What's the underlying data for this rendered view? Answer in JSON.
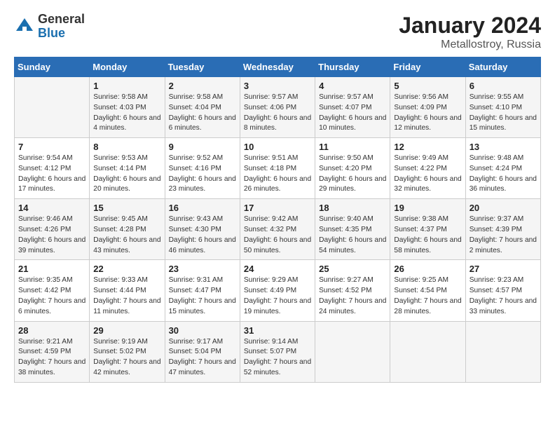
{
  "header": {
    "logo_general": "General",
    "logo_blue": "Blue",
    "title": "January 2024",
    "subtitle": "Metallostroy, Russia"
  },
  "days_of_week": [
    "Sunday",
    "Monday",
    "Tuesday",
    "Wednesday",
    "Thursday",
    "Friday",
    "Saturday"
  ],
  "weeks": [
    [
      {
        "day": "",
        "sunrise": "",
        "sunset": "",
        "daylight": ""
      },
      {
        "day": "1",
        "sunrise": "Sunrise: 9:58 AM",
        "sunset": "Sunset: 4:03 PM",
        "daylight": "Daylight: 6 hours and 4 minutes."
      },
      {
        "day": "2",
        "sunrise": "Sunrise: 9:58 AM",
        "sunset": "Sunset: 4:04 PM",
        "daylight": "Daylight: 6 hours and 6 minutes."
      },
      {
        "day": "3",
        "sunrise": "Sunrise: 9:57 AM",
        "sunset": "Sunset: 4:06 PM",
        "daylight": "Daylight: 6 hours and 8 minutes."
      },
      {
        "day": "4",
        "sunrise": "Sunrise: 9:57 AM",
        "sunset": "Sunset: 4:07 PM",
        "daylight": "Daylight: 6 hours and 10 minutes."
      },
      {
        "day": "5",
        "sunrise": "Sunrise: 9:56 AM",
        "sunset": "Sunset: 4:09 PM",
        "daylight": "Daylight: 6 hours and 12 minutes."
      },
      {
        "day": "6",
        "sunrise": "Sunrise: 9:55 AM",
        "sunset": "Sunset: 4:10 PM",
        "daylight": "Daylight: 6 hours and 15 minutes."
      }
    ],
    [
      {
        "day": "7",
        "sunrise": "Sunrise: 9:54 AM",
        "sunset": "Sunset: 4:12 PM",
        "daylight": "Daylight: 6 hours and 17 minutes."
      },
      {
        "day": "8",
        "sunrise": "Sunrise: 9:53 AM",
        "sunset": "Sunset: 4:14 PM",
        "daylight": "Daylight: 6 hours and 20 minutes."
      },
      {
        "day": "9",
        "sunrise": "Sunrise: 9:52 AM",
        "sunset": "Sunset: 4:16 PM",
        "daylight": "Daylight: 6 hours and 23 minutes."
      },
      {
        "day": "10",
        "sunrise": "Sunrise: 9:51 AM",
        "sunset": "Sunset: 4:18 PM",
        "daylight": "Daylight: 6 hours and 26 minutes."
      },
      {
        "day": "11",
        "sunrise": "Sunrise: 9:50 AM",
        "sunset": "Sunset: 4:20 PM",
        "daylight": "Daylight: 6 hours and 29 minutes."
      },
      {
        "day": "12",
        "sunrise": "Sunrise: 9:49 AM",
        "sunset": "Sunset: 4:22 PM",
        "daylight": "Daylight: 6 hours and 32 minutes."
      },
      {
        "day": "13",
        "sunrise": "Sunrise: 9:48 AM",
        "sunset": "Sunset: 4:24 PM",
        "daylight": "Daylight: 6 hours and 36 minutes."
      }
    ],
    [
      {
        "day": "14",
        "sunrise": "Sunrise: 9:46 AM",
        "sunset": "Sunset: 4:26 PM",
        "daylight": "Daylight: 6 hours and 39 minutes."
      },
      {
        "day": "15",
        "sunrise": "Sunrise: 9:45 AM",
        "sunset": "Sunset: 4:28 PM",
        "daylight": "Daylight: 6 hours and 43 minutes."
      },
      {
        "day": "16",
        "sunrise": "Sunrise: 9:43 AM",
        "sunset": "Sunset: 4:30 PM",
        "daylight": "Daylight: 6 hours and 46 minutes."
      },
      {
        "day": "17",
        "sunrise": "Sunrise: 9:42 AM",
        "sunset": "Sunset: 4:32 PM",
        "daylight": "Daylight: 6 hours and 50 minutes."
      },
      {
        "day": "18",
        "sunrise": "Sunrise: 9:40 AM",
        "sunset": "Sunset: 4:35 PM",
        "daylight": "Daylight: 6 hours and 54 minutes."
      },
      {
        "day": "19",
        "sunrise": "Sunrise: 9:38 AM",
        "sunset": "Sunset: 4:37 PM",
        "daylight": "Daylight: 6 hours and 58 minutes."
      },
      {
        "day": "20",
        "sunrise": "Sunrise: 9:37 AM",
        "sunset": "Sunset: 4:39 PM",
        "daylight": "Daylight: 7 hours and 2 minutes."
      }
    ],
    [
      {
        "day": "21",
        "sunrise": "Sunrise: 9:35 AM",
        "sunset": "Sunset: 4:42 PM",
        "daylight": "Daylight: 7 hours and 6 minutes."
      },
      {
        "day": "22",
        "sunrise": "Sunrise: 9:33 AM",
        "sunset": "Sunset: 4:44 PM",
        "daylight": "Daylight: 7 hours and 11 minutes."
      },
      {
        "day": "23",
        "sunrise": "Sunrise: 9:31 AM",
        "sunset": "Sunset: 4:47 PM",
        "daylight": "Daylight: 7 hours and 15 minutes."
      },
      {
        "day": "24",
        "sunrise": "Sunrise: 9:29 AM",
        "sunset": "Sunset: 4:49 PM",
        "daylight": "Daylight: 7 hours and 19 minutes."
      },
      {
        "day": "25",
        "sunrise": "Sunrise: 9:27 AM",
        "sunset": "Sunset: 4:52 PM",
        "daylight": "Daylight: 7 hours and 24 minutes."
      },
      {
        "day": "26",
        "sunrise": "Sunrise: 9:25 AM",
        "sunset": "Sunset: 4:54 PM",
        "daylight": "Daylight: 7 hours and 28 minutes."
      },
      {
        "day": "27",
        "sunrise": "Sunrise: 9:23 AM",
        "sunset": "Sunset: 4:57 PM",
        "daylight": "Daylight: 7 hours and 33 minutes."
      }
    ],
    [
      {
        "day": "28",
        "sunrise": "Sunrise: 9:21 AM",
        "sunset": "Sunset: 4:59 PM",
        "daylight": "Daylight: 7 hours and 38 minutes."
      },
      {
        "day": "29",
        "sunrise": "Sunrise: 9:19 AM",
        "sunset": "Sunset: 5:02 PM",
        "daylight": "Daylight: 7 hours and 42 minutes."
      },
      {
        "day": "30",
        "sunrise": "Sunrise: 9:17 AM",
        "sunset": "Sunset: 5:04 PM",
        "daylight": "Daylight: 7 hours and 47 minutes."
      },
      {
        "day": "31",
        "sunrise": "Sunrise: 9:14 AM",
        "sunset": "Sunset: 5:07 PM",
        "daylight": "Daylight: 7 hours and 52 minutes."
      },
      {
        "day": "",
        "sunrise": "",
        "sunset": "",
        "daylight": ""
      },
      {
        "day": "",
        "sunrise": "",
        "sunset": "",
        "daylight": ""
      },
      {
        "day": "",
        "sunrise": "",
        "sunset": "",
        "daylight": ""
      }
    ]
  ]
}
